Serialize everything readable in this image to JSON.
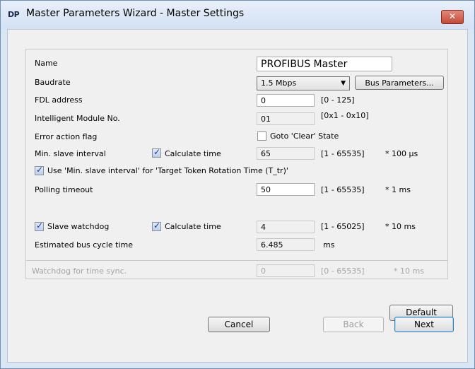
{
  "window": {
    "logo": "DP",
    "title": "Master Parameters Wizard - Master Settings",
    "close_icon": "close-icon"
  },
  "form": {
    "name_label": "Name",
    "name_value": "PROFIBUS Master",
    "baudrate_label": "Baudrate",
    "baudrate_value": "1.5 Mbps",
    "bus_params_button": "Bus Parameters...",
    "fdl_label": "FDL address",
    "fdl_value": "0",
    "fdl_range": "[0 - 125]",
    "imn_label": "Intelligent Module No.",
    "imn_value": "01",
    "imn_range": "[0x1 - 0x10]",
    "error_flag_label": "Error action flag",
    "goto_clear_label": "Goto 'Clear' State",
    "min_slave_label": "Min. slave interval",
    "calc_time_label": "Calculate time",
    "min_slave_value": "65",
    "min_slave_range": "[1 - 65535]",
    "min_slave_unit": "* 100 µs",
    "use_min_slave_label": "Use 'Min. slave interval' for 'Target Token Rotation Time (T_tr)'",
    "polling_label": "Polling timeout",
    "polling_value": "50",
    "polling_range": "[1 - 65535]",
    "polling_unit": "* 1 ms",
    "slave_wd_label": "Slave watchdog",
    "calc_time_label2": "Calculate time",
    "slave_wd_value": "4",
    "slave_wd_range": "[1 - 65025]",
    "slave_wd_unit": "* 10 ms",
    "est_cycle_label": "Estimated bus cycle time",
    "est_cycle_value": "6.485",
    "est_cycle_unit": "ms",
    "wd_sync_label": "Watchdog for time sync.",
    "wd_sync_value": "0",
    "wd_sync_range": "[0 - 65535]",
    "wd_sync_unit": "* 10 ms"
  },
  "checks": {
    "goto_clear": false,
    "min_slave_calc": true,
    "use_min_slave": true,
    "slave_wd": true,
    "slave_wd_calc": true
  },
  "buttons": {
    "default": "Default",
    "cancel": "Cancel",
    "back": "Back",
    "next": "Next"
  }
}
